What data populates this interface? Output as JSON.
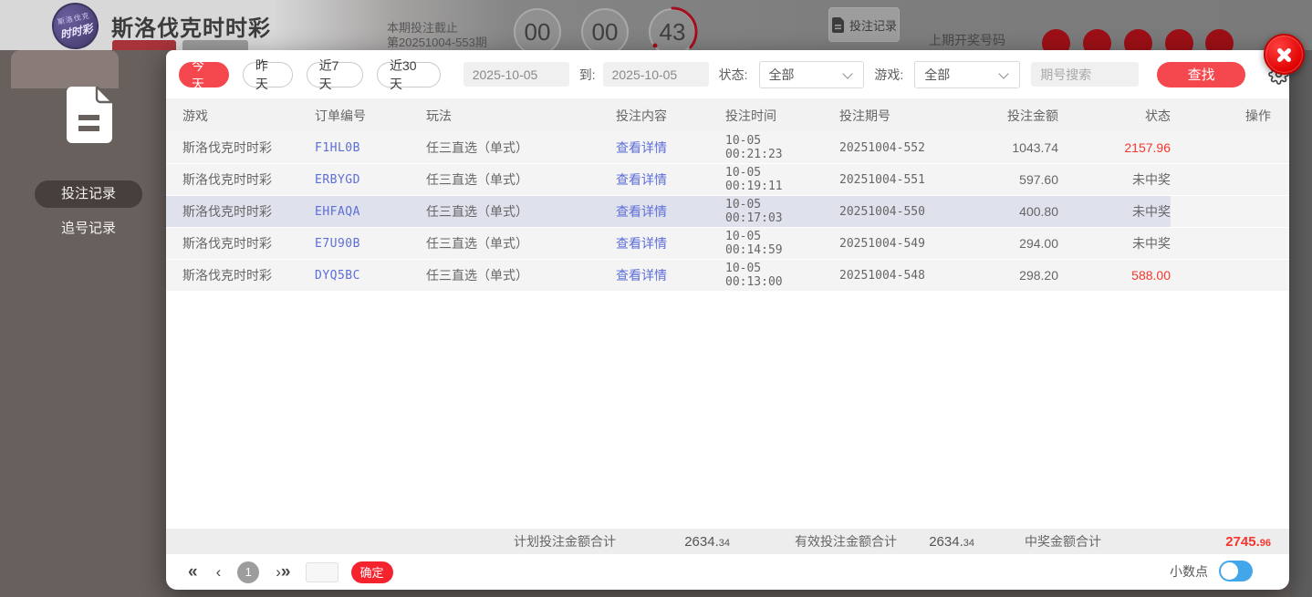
{
  "colors": {
    "accent_red": "#f4474e",
    "link_blue": "#5d6ed7",
    "win_red": "#f5362e",
    "toggle_blue": "#42a6ea",
    "highlight_row": "#dfe1ed",
    "ball_red": "#9c1016",
    "logo_purple": "#4c4176"
  },
  "icons": {
    "sidebar_file": "file-icon",
    "record_button_file": "file-icon",
    "settings": "gear-icon",
    "close": "close-icon",
    "dropdown": "chevron-down-icon"
  },
  "page_header": {
    "logo_line1": "斯洛伐克",
    "logo_line2": "时时彩",
    "title": "斯洛伐克时时彩",
    "deadline_line1": "本期投注截止",
    "deadline_line2": "第20251004-553期",
    "countdown": {
      "hours": "00",
      "minutes": "00",
      "seconds": "43"
    },
    "bet_record_button": "投注记录",
    "last_draw_label": "上期开奖号码"
  },
  "sidebar": {
    "items": [
      {
        "label": "投注记录",
        "active": true
      },
      {
        "label": "追号记录",
        "active": false
      }
    ]
  },
  "filters": {
    "quick_ranges": [
      "今天",
      "昨天",
      "近7天",
      "近30天"
    ],
    "active_range": "今天",
    "date_from": "2025-10-05",
    "to_label": "到:",
    "date_to": "2025-10-05",
    "status_label": "状态:",
    "status_value": "全部",
    "game_label": "游戏:",
    "game_value": "全部",
    "search_placeholder": "期号搜索",
    "search_button": "查找"
  },
  "table": {
    "headers": [
      "游戏",
      "订单编号",
      "玩法",
      "投注内容",
      "投注时间",
      "投注期号",
      "投注金额",
      "状态",
      "操作"
    ],
    "detail_link": "查看详情",
    "rows": [
      {
        "game": "斯洛伐克时时彩",
        "order": "F1HL0B",
        "play": "任三直选（单式）",
        "time": "10-05 00:21:23",
        "period": "20251004-552",
        "amount": "1043.74",
        "status": "2157.96",
        "win": true,
        "highlighted": false
      },
      {
        "game": "斯洛伐克时时彩",
        "order": "ERBYGD",
        "play": "任三直选（单式）",
        "time": "10-05 00:19:11",
        "period": "20251004-551",
        "amount": "597.60",
        "status": "未中奖",
        "win": false,
        "highlighted": false
      },
      {
        "game": "斯洛伐克时时彩",
        "order": "EHFAQA",
        "play": "任三直选（单式）",
        "time": "10-05 00:17:03",
        "period": "20251004-550",
        "amount": "400.80",
        "status": "未中奖",
        "win": false,
        "highlighted": true
      },
      {
        "game": "斯洛伐克时时彩",
        "order": "E7U90B",
        "play": "任三直选（单式）",
        "time": "10-05 00:14:59",
        "period": "20251004-549",
        "amount": "294.00",
        "status": "未中奖",
        "win": false,
        "highlighted": false
      },
      {
        "game": "斯洛伐克时时彩",
        "order": "DYQ5BC",
        "play": "任三直选（单式）",
        "time": "10-05 00:13:00",
        "period": "20251004-548",
        "amount": "298.20",
        "status": "588.00",
        "win": true,
        "highlighted": false
      }
    ]
  },
  "totals": {
    "planned_label": "计划投注金额合计",
    "planned_int": "2634.",
    "planned_dec": "34",
    "valid_label": "有效投注金额合计",
    "valid_int": "2634.",
    "valid_dec": "34",
    "win_label": "中奖金额合计",
    "win_int": "2745.",
    "win_dec": "96"
  },
  "pagination": {
    "current_page": "1",
    "confirm_button": "确定",
    "decimal_label": "小数点"
  }
}
